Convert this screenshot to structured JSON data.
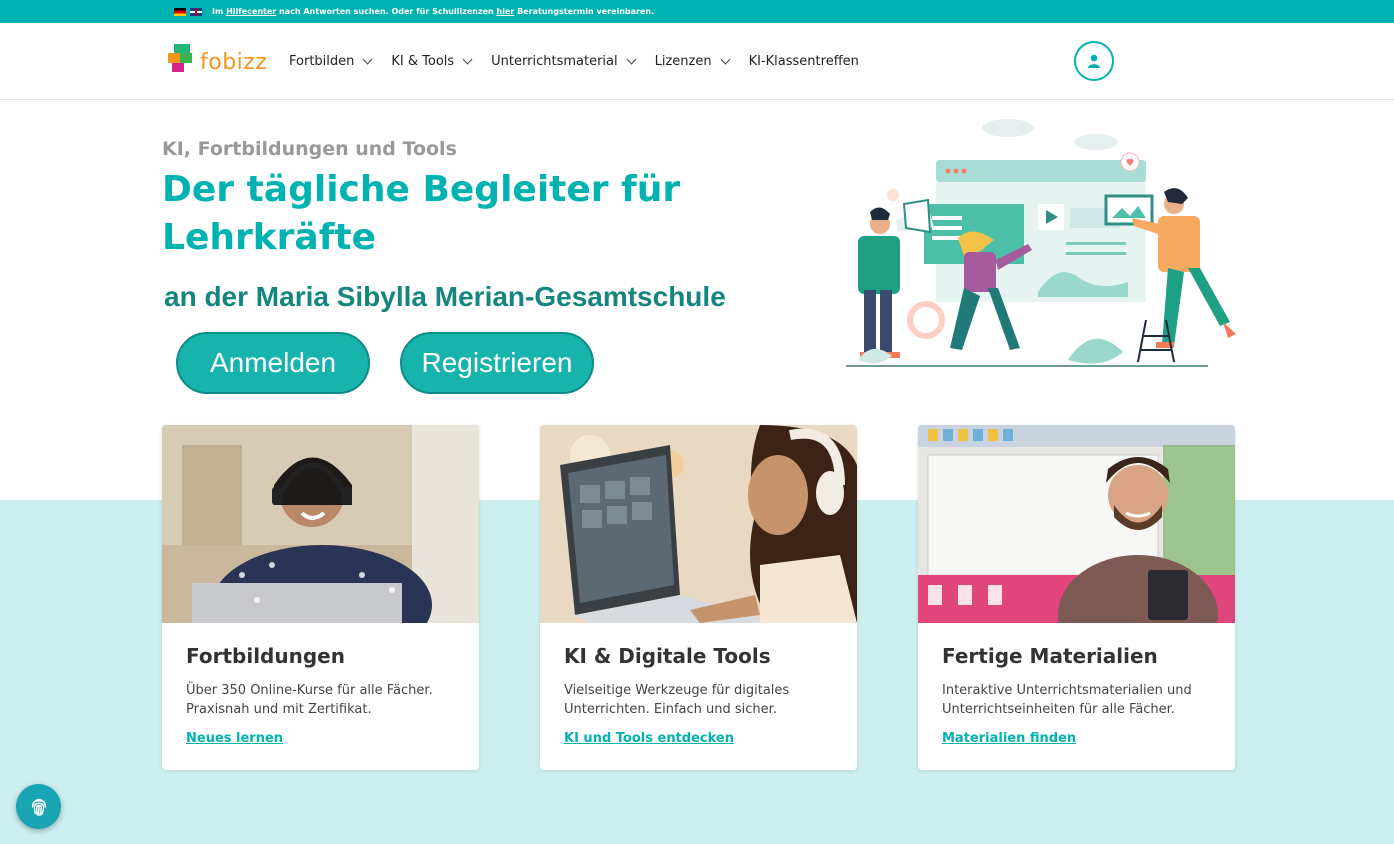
{
  "topbar": {
    "pre": "Im ",
    "link1": "Hilfecenter",
    "mid": " nach Antworten suchen. Oder für Schullizenzen ",
    "link2": "hier",
    "post": " Beratungstermin vereinbaren."
  },
  "logo": {
    "text": "fobizz"
  },
  "nav": {
    "items": [
      {
        "label": "Fortbilden",
        "icon": "chevron-down-icon"
      },
      {
        "label": "KI & Tools",
        "icon": "chevron-down-icon"
      },
      {
        "label": "Unterrichtsmaterial",
        "icon": "chevron-down-icon"
      },
      {
        "label": "Lizenzen",
        "icon": "chevron-down-icon"
      },
      {
        "label": "KI-Klassentreffen"
      }
    ]
  },
  "hero": {
    "subtitle": "KI, Fortbildungen und Tools",
    "headline": "Der tägliche Begleiter für Lehrkräfte",
    "school": "an der Maria Sibylla Merian-Gesamtschule",
    "login_label": "Anmelden",
    "register_label": "Registrieren"
  },
  "cards": [
    {
      "title": "Fortbildungen",
      "text": "Über 350 Online-Kurse für alle Fächer. Praxisnah und mit Zertifikat.",
      "link": "Neues lernen"
    },
    {
      "title": "KI & Digitale Tools",
      "text": "Vielseitige Werkzeuge für digitales Unterrichten. Einfach und sicher.",
      "link": "KI und Tools entdecken"
    },
    {
      "title": "Fertige Materialien",
      "text": "Interaktive Unterrichtsmaterialien und Unterrichtseinheiten für alle Fächer.",
      "link": "Materialien finden"
    }
  ],
  "colors": {
    "accent": "#00b3b0",
    "school_text": "#14857f",
    "section_bg": "#cdeff0"
  }
}
